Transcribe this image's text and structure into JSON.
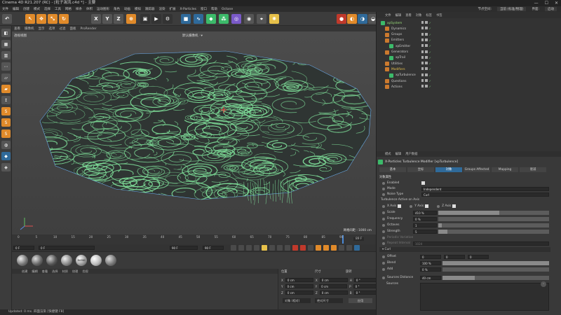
{
  "window": {
    "title": "Cinema 4D R21.207 (RC) - [粒子湍流.c4d *] - 主要",
    "controls": [
      "—",
      "☐",
      "✕"
    ]
  },
  "menu": {
    "items": [
      "文件",
      "编辑",
      "创建",
      "模式",
      "选择",
      "工具",
      "网格",
      "样条",
      "体积",
      "运动图形",
      "角色",
      "动画",
      "模拟",
      "跟踪器",
      "渲染",
      "扩展",
      "X-Particles",
      "窗口",
      "帮助",
      "Octane"
    ],
    "right_label": "节点空间:",
    "layout_label": "当前 (标准/物理)",
    "interface_label": "界面:",
    "interface_value": "启动"
  },
  "viewport": {
    "menu": [
      "查看",
      "摄像机",
      "显示",
      "选项",
      "过滤",
      "面板",
      "ProRender"
    ],
    "label": "透视视图",
    "camera_label": "默认摄像机 ◦▾",
    "grid_spacing": "网格间距 : 1000 cm"
  },
  "timeline": {
    "ticks": [
      "0",
      "5",
      "10",
      "15",
      "20",
      "25",
      "30",
      "35",
      "40",
      "45",
      "50",
      "55",
      "60",
      "65",
      "70",
      "75",
      "80",
      "85",
      "90"
    ],
    "current_frame": "89 F",
    "start": "0 F",
    "start2": "0 F",
    "end": "90 F",
    "end2": "90 F"
  },
  "materials": {
    "menu": [
      "创建",
      "编辑",
      "查看",
      "选择",
      "材质",
      "纹理",
      "优视"
    ],
    "blend_label": "BLEND"
  },
  "coords": {
    "headers": [
      "位置",
      "尺寸",
      "旋转"
    ],
    "rows": [
      {
        "axis": "X",
        "pos": "0 cm",
        "size": "0 cm",
        "rot_axis": "H",
        "rot": "0 °"
      },
      {
        "axis": "Y",
        "pos": "0 cm",
        "size": "0 cm",
        "rot_axis": "P",
        "rot": "0 °"
      },
      {
        "axis": "Z",
        "pos": "0 cm",
        "size": "0 cm",
        "rot_axis": "B",
        "rot": "0 °"
      }
    ],
    "mode1": "对象 (相对)",
    "mode2": "绝对尺寸",
    "apply": "应用"
  },
  "status": {
    "text": "Updated: 0 ms.  四面渲染 [快捷键 F8]"
  },
  "objects": {
    "menu": [
      "文件",
      "编辑",
      "查看",
      "对象",
      "标签",
      "书签"
    ],
    "items": [
      {
        "label": "xpSystem",
        "indent": 0,
        "color": "#3cba6a",
        "label_color": "#9be07a"
      },
      {
        "label": "Dynamics",
        "indent": 1,
        "color": "#cc7a2e",
        "label_color": "#c8c8c8"
      },
      {
        "label": "Groups",
        "indent": 1,
        "color": "#cc7a2e",
        "label_color": "#c8c8c8"
      },
      {
        "label": "Emitters",
        "indent": 1,
        "color": "#cc7a2e",
        "label_color": "#c8c8c8"
      },
      {
        "label": "xpEmitter",
        "indent": 2,
        "color": "#3cba6a",
        "label_color": "#c8c8c8"
      },
      {
        "label": "Generators",
        "indent": 1,
        "color": "#cc7a2e",
        "label_color": "#c8c8c8"
      },
      {
        "label": "xpTrail",
        "indent": 2,
        "color": "#3cba6a",
        "label_color": "#c8c8c8"
      },
      {
        "label": "Utilities",
        "indent": 1,
        "color": "#cc7a2e",
        "label_color": "#c8c8c8"
      },
      {
        "label": "Modifiers",
        "indent": 1,
        "color": "#cc7a2e",
        "label_color": "#e6c04a"
      },
      {
        "label": "xpTurbulence",
        "indent": 2,
        "color": "#3cba6a",
        "label_color": "#c8c8c8"
      },
      {
        "label": "Questions",
        "indent": 1,
        "color": "#cc7a2e",
        "label_color": "#c8c8c8"
      },
      {
        "label": "Actions",
        "indent": 1,
        "color": "#cc7a2e",
        "label_color": "#c8c8c8"
      }
    ]
  },
  "attributes": {
    "menu": [
      "模式",
      "编辑",
      "用户数据"
    ],
    "header": "X-Particles Turbulence Modifier [xpTurbulence]",
    "tabs": [
      "基本",
      "坐标",
      "对象",
      "Groups Affected",
      "Mapping",
      "衰减"
    ],
    "active_tab": "对象",
    "section": "对象属性",
    "enabled_label": "Enabled",
    "mode_label": "Mode",
    "mode_value": "Independent",
    "noise_label": "Noise Type",
    "noise_value": "Curl",
    "axis_label": "Turbulence Active on Axis",
    "x_axis": "X Axis",
    "y_axis": "Y Axis",
    "z_axis": "Z Axis",
    "scale_label": "Scale",
    "scale_value": "410 %",
    "frequency_label": "Frequency",
    "frequency_value": "0 %",
    "octaves_label": "Octaves",
    "octaves_value": "1",
    "strength_label": "Strength",
    "strength_value": "5",
    "periodic_label": "Periodic Variation",
    "repeat_label": "Repeat Interval",
    "repeat_value": "1024",
    "curl_section": "Curl",
    "offset_label": "Offset",
    "offset_values": [
      "0",
      "0",
      "0"
    ],
    "blend_label": "Blend",
    "blend_value": "100 %",
    "add_label": "Add",
    "add_value": "0 %",
    "sources_distance_label": "Sources Distance",
    "sources_distance_value": "40 cm",
    "sources_label": "Sources",
    "levels": {
      "scale": 0.55,
      "frequency": 0.0,
      "octaves": 0.03,
      "strength": 0.08,
      "blend": 1.0,
      "add": 0.0,
      "sources_distance": 0.3
    }
  },
  "colors": {
    "particles": "#7fe09a",
    "accent_orange": "#e08a2a",
    "active_tab": "#2f6a9a",
    "object_green": "#3cba6a"
  },
  "icons": {
    "toolbar": [
      "undo-icon",
      "select-icon",
      "move-icon",
      "scale-icon",
      "rotate-icon",
      "axis-x-icon",
      "axis-y-icon",
      "axis-z-icon",
      "coord-icon",
      "render-region-icon",
      "render-view-icon",
      "render-settings-icon",
      "cube-icon",
      "spline-icon",
      "nurbs-icon",
      "array-icon",
      "deformer-icon",
      "scene-icon",
      "camera-icon",
      "light-icon"
    ]
  }
}
